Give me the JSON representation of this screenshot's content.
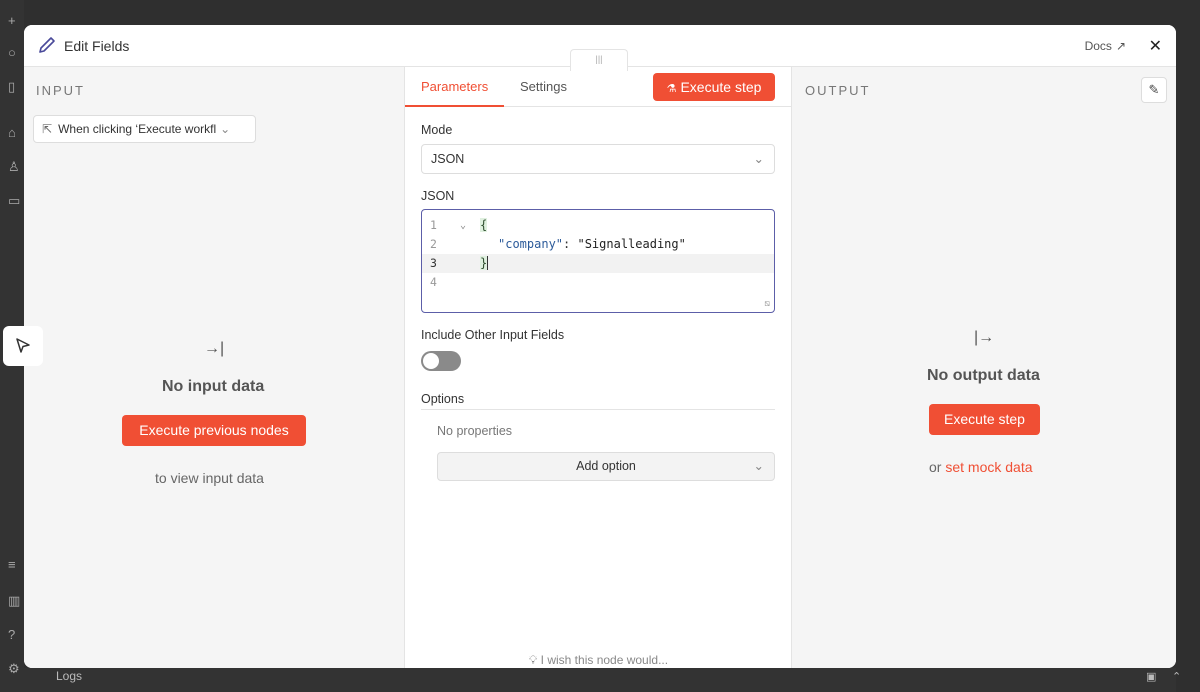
{
  "modal": {
    "title": "Edit Fields",
    "docs_label": "Docs",
    "close_glyph": "✕",
    "drag_glyph": "|||"
  },
  "input": {
    "label": "INPUT",
    "trigger_select": "When clicking ‘Execute workfl",
    "empty_title": "No input data",
    "exec_prev_label": "Execute previous nodes",
    "hint": "to view input data"
  },
  "center": {
    "tabs": [
      {
        "label": "Parameters",
        "active": true
      },
      {
        "label": "Settings",
        "active": false
      }
    ],
    "exec_step_label": "Execute step",
    "mode_label": "Mode",
    "mode_value": "JSON",
    "json_label": "JSON",
    "code_lines": [
      {
        "n": "1",
        "text": "{"
      },
      {
        "n": "2",
        "key": "\"company\"",
        "sep": ": ",
        "value": "\"Signalleading\""
      },
      {
        "n": "3",
        "text": "}"
      },
      {
        "n": "4",
        "text": ""
      }
    ],
    "include_label": "Include Other Input Fields",
    "include_enabled": false,
    "options_label": "Options",
    "no_properties": "No properties",
    "add_option_label": "Add option",
    "wish_label": "I wish this node would..."
  },
  "output": {
    "label": "OUTPUT",
    "empty_title": "No output data",
    "exec_step_label": "Execute step",
    "or_text": "or ",
    "mock_link": "set mock data"
  },
  "background": {
    "logs_label": "Logs"
  },
  "colors": {
    "accent": "#f04f34",
    "editor_border": "#5c5ea8"
  }
}
